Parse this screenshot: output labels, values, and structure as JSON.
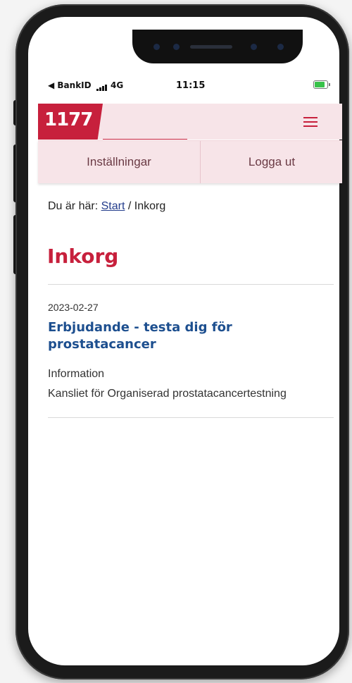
{
  "status_bar": {
    "carrier": "◀ BankID",
    "network": "4G",
    "time": "11:15",
    "battery_level": 0.85,
    "battery_charging": true,
    "battery_color": "#38c24a"
  },
  "header": {
    "logo_text": "1177",
    "brand_color": "#c7203c",
    "menu_icon": "hamburger-menu-icon"
  },
  "account_bar": {
    "settings_label": "Inställningar",
    "logout_label": "Logga ut"
  },
  "breadcrumb": {
    "prefix": "Du är här:",
    "start_link": "Start",
    "separator": "/",
    "current": "Inkorg"
  },
  "page": {
    "title": "Inkorg"
  },
  "messages": [
    {
      "date": "2023-02-27",
      "title": "Erbjudande - testa dig för prostatacancer",
      "category": "Information",
      "sender": "Kansliet för Organiserad prostatacancertestning"
    }
  ]
}
